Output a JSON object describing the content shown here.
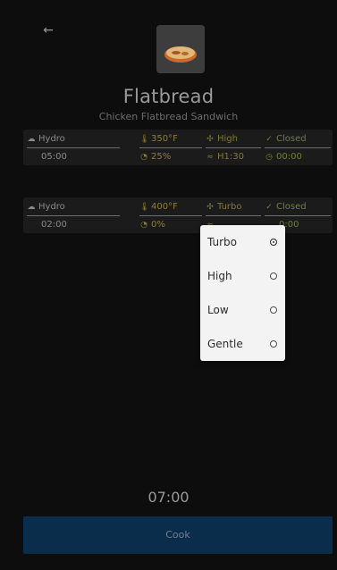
{
  "header": {
    "back_icon": "arrow-left-icon"
  },
  "recipe": {
    "title": "Flatbread",
    "subtitle": "Chicken Flatbread Sandwich",
    "image_icon": "flatbread-photo"
  },
  "steps": [
    {
      "mode": "Hydro",
      "temp": "350°F",
      "fan": "High",
      "option": "Closed",
      "time": "05:00",
      "humidity": "25%",
      "energy": "H1:30",
      "extra": "00:00"
    },
    {
      "mode": "Hydro",
      "temp": "400°F",
      "fan": "Turbo",
      "option": "Closed",
      "time": "02:00",
      "humidity": "0%",
      "energy": "",
      "extra": "0:00"
    }
  ],
  "fan_dropdown": {
    "options": [
      {
        "label": "Turbo",
        "selected": true
      },
      {
        "label": "High",
        "selected": false
      },
      {
        "label": "Low",
        "selected": false
      },
      {
        "label": "Gentle",
        "selected": false
      }
    ]
  },
  "total_time": "07:00",
  "cook_button": "Cook",
  "colors": {
    "background": "#0d0d0d",
    "card": "#1b1b1b",
    "accent_yellow": "#8b7f2d",
    "accent_green": "#6f7f3a",
    "cook_button_bg": "#0b2d4c"
  }
}
